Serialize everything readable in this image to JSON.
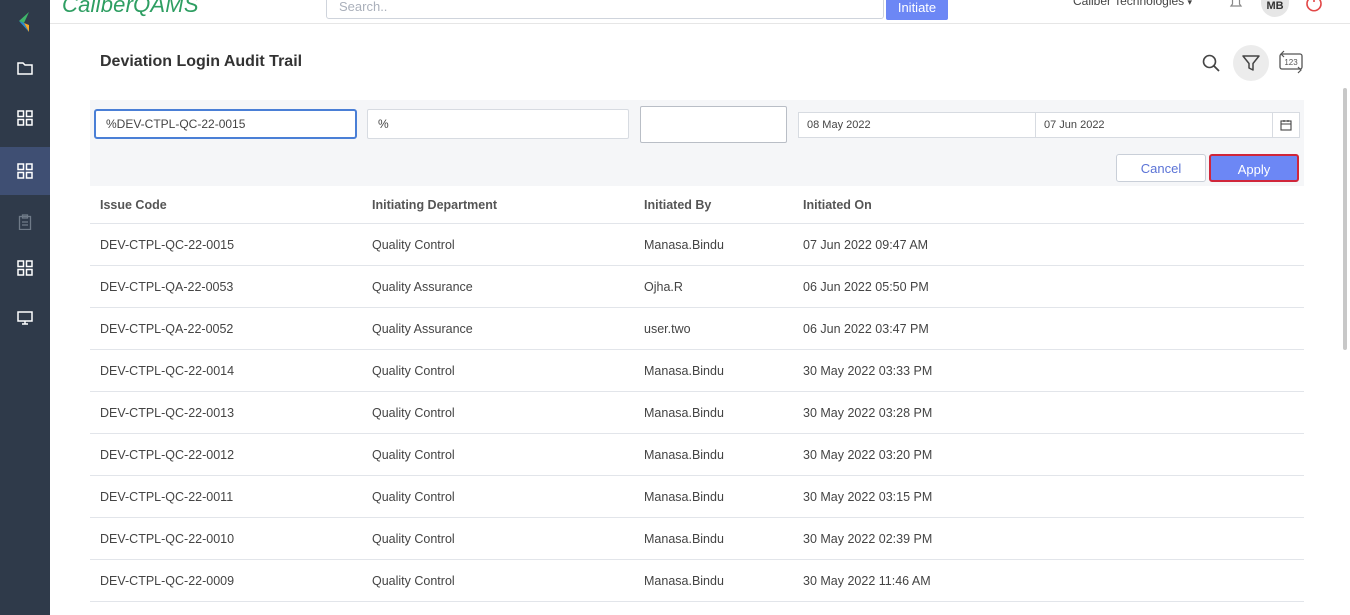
{
  "app": {
    "logo_text_bold": "Caliber",
    "logo_text_thin": "QAMS",
    "search_placeholder": "Search..",
    "initiate_label": "Initiate",
    "org_name": "Caliber Technologies",
    "avatar_initials": "MB"
  },
  "page": {
    "title": "Deviation Login Audit Trail"
  },
  "filters": {
    "issue_code": "%DEV-CTPL-QC-22-0015",
    "department": "%",
    "initiated_by": "",
    "date_from": "08 May 2022",
    "date_to": "07 Jun 2022",
    "cancel_label": "Cancel",
    "apply_label": "Apply"
  },
  "table": {
    "headers": [
      "Issue Code",
      "Initiating Department",
      "Initiated By",
      "Initiated On"
    ],
    "rows": [
      [
        "DEV-CTPL-QC-22-0015",
        "Quality Control",
        "Manasa.Bindu",
        "07 Jun 2022 09:47 AM"
      ],
      [
        "DEV-CTPL-QA-22-0053",
        "Quality Assurance",
        "Ojha.R",
        "06 Jun 2022 05:50 PM"
      ],
      [
        "DEV-CTPL-QA-22-0052",
        "Quality Assurance",
        "user.two",
        "06 Jun 2022 03:47 PM"
      ],
      [
        "DEV-CTPL-QC-22-0014",
        "Quality Control",
        "Manasa.Bindu",
        "30 May 2022 03:33 PM"
      ],
      [
        "DEV-CTPL-QC-22-0013",
        "Quality Control",
        "Manasa.Bindu",
        "30 May 2022 03:28 PM"
      ],
      [
        "DEV-CTPL-QC-22-0012",
        "Quality Control",
        "Manasa.Bindu",
        "30 May 2022 03:20 PM"
      ],
      [
        "DEV-CTPL-QC-22-0011",
        "Quality Control",
        "Manasa.Bindu",
        "30 May 2022 03:15 PM"
      ],
      [
        "DEV-CTPL-QC-22-0010",
        "Quality Control",
        "Manasa.Bindu",
        "30 May 2022 02:39 PM"
      ],
      [
        "DEV-CTPL-QC-22-0009",
        "Quality Control",
        "Manasa.Bindu",
        "30 May 2022 11:46 AM"
      ]
    ]
  },
  "sidebar": {
    "items": [
      {
        "icon": "logo-icon"
      },
      {
        "icon": "folder-icon"
      },
      {
        "icon": "grid-icon"
      },
      {
        "icon": "grid-icon",
        "active": true
      },
      {
        "icon": "clipboard-icon"
      },
      {
        "icon": "grid-icon"
      },
      {
        "icon": "monitor-icon"
      }
    ]
  },
  "colors": {
    "sidebar_bg": "#2f3a4a",
    "sidebar_active": "#3f4f73",
    "accent": "#6c87f5",
    "apply_border": "#d0263a",
    "brand_green": "#2e9e62"
  }
}
